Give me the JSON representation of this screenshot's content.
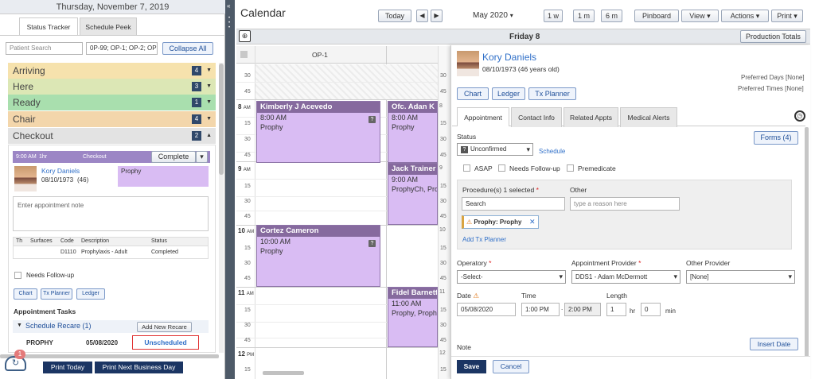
{
  "left": {
    "date_header": "Thursday, November 7, 2019",
    "tabs": [
      "Status Tracker",
      "Schedule Peek"
    ],
    "patient_search_placeholder": "Patient Search",
    "ops_filter": "0P-99; OP-1; OP-2; OP",
    "collapse_all": "Collapse All",
    "statuses": [
      {
        "label": "Arriving",
        "count": "4",
        "color": "#f6e2ad"
      },
      {
        "label": "Here",
        "count": "3",
        "color": "#dce7b5"
      },
      {
        "label": "Ready",
        "count": "1",
        "color": "#a9dfae"
      },
      {
        "label": "Chair",
        "count": "4",
        "color": "#f3d6ab"
      },
      {
        "label": "Checkout",
        "count": "2",
        "color": "#e3e3e3"
      }
    ],
    "checkout": {
      "time": "9:00 AM",
      "duration": "1hr",
      "status_label": "Checkout",
      "complete_button": "Complete",
      "patient_name": "Kory Daniels",
      "patient_dob": "08/10/1973",
      "patient_age": "(46)",
      "procedure_tag": "Prophy",
      "note_placeholder": "Enter appointment note",
      "table_headers": [
        "Th",
        "Surfaces",
        "Code",
        "Description",
        "Status"
      ],
      "table_rows": [
        [
          "",
          "",
          "D1110",
          "Prophylaxis - Adult",
          "Completed"
        ]
      ],
      "needs_followup": "Needs Follow-up",
      "buttons": [
        "Chart",
        "Tx Planner",
        "Ledger"
      ],
      "appointment_tasks": "Appointment Tasks",
      "schedule_recare": "Schedule Recare (1)",
      "add_new_recare": "Add New Recare",
      "recare_row": {
        "type": "PROPHY",
        "date": "05/08/2020",
        "status": "Unscheduled"
      }
    },
    "notif_badge": "1",
    "print_today": "Print Today",
    "print_next": "Print Next Business Day"
  },
  "calendar": {
    "title": "Calendar",
    "today": "Today",
    "month": "May 2020",
    "week_buttons": [
      "1 w",
      "1 m",
      "6 m"
    ],
    "pinboard": "Pinboard",
    "view": "View",
    "actions": "Actions",
    "print": "Print",
    "day_title": "Friday 8",
    "production_totals": "Production Totals",
    "op_header": "OP-1",
    "hours": [
      {
        "label": "8",
        "ampm": "AM"
      },
      {
        "label": "9",
        "ampm": "AM"
      },
      {
        "label": "10",
        "ampm": "AM"
      },
      {
        "label": "11",
        "ampm": "AM"
      },
      {
        "label": "12",
        "ampm": "PM"
      }
    ],
    "appointments": [
      {
        "name": "Kimberly J Acevedo",
        "time": "8:00 AM",
        "proc": "Prophy"
      },
      {
        "name": "Ofc. Adan K",
        "time": "8:00 AM",
        "proc": "Prophy"
      },
      {
        "name": "Jack Trainer",
        "time": "9:00 AM",
        "proc": "ProphyCh, Pro"
      },
      {
        "name": "Cortez Cameron",
        "time": "10:00 AM",
        "proc": "Prophy"
      },
      {
        "name": "Fidel Barnett",
        "time": "11:00 AM",
        "proc": "Prophy, Proph"
      }
    ]
  },
  "detail": {
    "patient_name": "Kory Daniels",
    "patient_dob": "08/10/1973 (46 years old)",
    "preferred_days": "Preferred Days [None]",
    "preferred_times": "Preferred Times [None]",
    "buttons": [
      "Chart",
      "Ledger",
      "Tx Planner"
    ],
    "tabs": [
      "Appointment",
      "Contact Info",
      "Related Appts",
      "Medical Alerts"
    ],
    "forms_button": "Forms (4)",
    "status_label": "Status",
    "status_value": "Unconfirmed",
    "schedule_link": "Schedule",
    "checkboxes": [
      "ASAP",
      "Needs Follow-up",
      "Premedicate"
    ],
    "procedures_label": "Procedure(s) 1 selected",
    "other_label": "Other",
    "search_value": "Search",
    "reason_placeholder": "type a reason here",
    "proc_chip": "Prophy: Prophy",
    "add_tx_planner": "Add Tx Planner",
    "operatory_label": "Operatory",
    "operatory_value": "-Select-",
    "provider_label": "Appointment Provider",
    "provider_value": "DDS1 - Adam McDermott",
    "other_provider_label": "Other Provider",
    "other_provider_value": "[None]",
    "date_label": "Date",
    "time_label": "Time",
    "length_label": "Length",
    "date_value": "05/08/2020",
    "start_time": "1:00 PM",
    "end_time": "2:00 PM",
    "length_hr": "1",
    "length_min": "0",
    "hr_unit": "hr",
    "min_unit": "min",
    "note_label": "Note",
    "insert_date": "Insert Date",
    "save": "Save",
    "cancel": "Cancel"
  }
}
